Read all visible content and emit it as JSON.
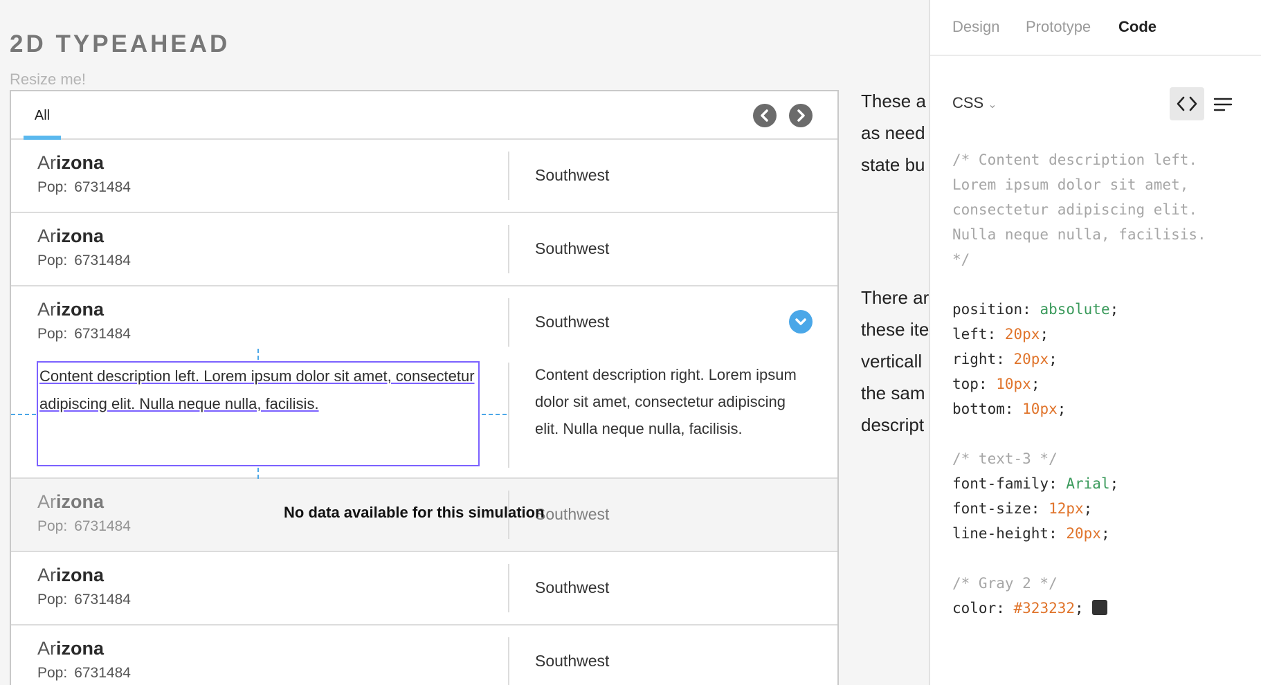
{
  "header": {
    "title": "2D TYPEAHEAD",
    "subtitle": "Resize me!"
  },
  "typeahead": {
    "tab_all": "All",
    "rows": [
      {
        "name_prefix": "Ar",
        "name_match": "izona",
        "pop_label": "Pop:",
        "pop_value": "6731484",
        "region": "Southwest"
      },
      {
        "name_prefix": "Ar",
        "name_match": "izona",
        "pop_label": "Pop:",
        "pop_value": "6731484",
        "region": "Southwest"
      },
      {
        "name_prefix": "Ar",
        "name_match": "izona",
        "pop_label": "Pop:",
        "pop_value": "6731484",
        "region": "Southwest",
        "desc_left": "Content description left. Lorem ipsum dolor sit amet, consectetur adipiscing elit. Nulla neque nulla, facilisis.",
        "desc_right": "Content description right. Lorem ipsum dolor sit amet, consectetur adipiscing elit. Nulla neque nulla, facilisis."
      },
      {
        "name_prefix": "Ar",
        "name_match": "izona",
        "pop_label": "Pop:",
        "pop_value": "6731484",
        "region": "Southwest"
      },
      {
        "name_prefix": "Ar",
        "name_match": "izona",
        "pop_label": "Pop:",
        "pop_value": "6731484",
        "region": "Southwest"
      },
      {
        "name_prefix": "Ar",
        "name_match": "izona",
        "pop_label": "Pop:",
        "pop_value": "6731484",
        "region": "Southwest"
      }
    ],
    "no_data_message": "No data available for this simulation"
  },
  "side_text": {
    "para1": "These a\nas need\nstate bu",
    "para2": "There ar\nthese ite\nverticall\nthe sam\ndescript"
  },
  "inspector": {
    "tabs": [
      "Design",
      "Prototype",
      "Code"
    ],
    "active_tab": "Code",
    "language": "CSS",
    "code": {
      "comment1_l1": "/* Content description left.",
      "comment1_l2": "Lorem ipsum dolor sit amet,",
      "comment1_l3": "consectetur adipiscing elit.",
      "comment1_l4": "Nulla neque nulla, facilisis.",
      "comment1_l5": "*/",
      "position_prop": "position",
      "position_val": "absolute",
      "left_prop": "left",
      "left_val": "20px",
      "right_prop": "right",
      "right_val": "20px",
      "top_prop": "top",
      "top_val": "10px",
      "bottom_prop": "bottom",
      "bottom_val": "10px",
      "comment2": "/* text-3 */",
      "font_family_prop": "font-family",
      "font_family_val": "Arial",
      "font_size_prop": "font-size",
      "font_size_val": "12px",
      "line_height_prop": "line-height",
      "line_height_val": "20px",
      "comment3": "/* Gray 2 */",
      "color_prop": "color",
      "color_val": "#323232"
    },
    "swatch_color": "#323232"
  },
  "colors": {
    "accent_blue": "#4aa7e8",
    "tab_underline": "#5ab8ee",
    "selection_purple": "#7b61ff",
    "code_keyword": "#3a9a5b",
    "code_number": "#e0742b"
  }
}
